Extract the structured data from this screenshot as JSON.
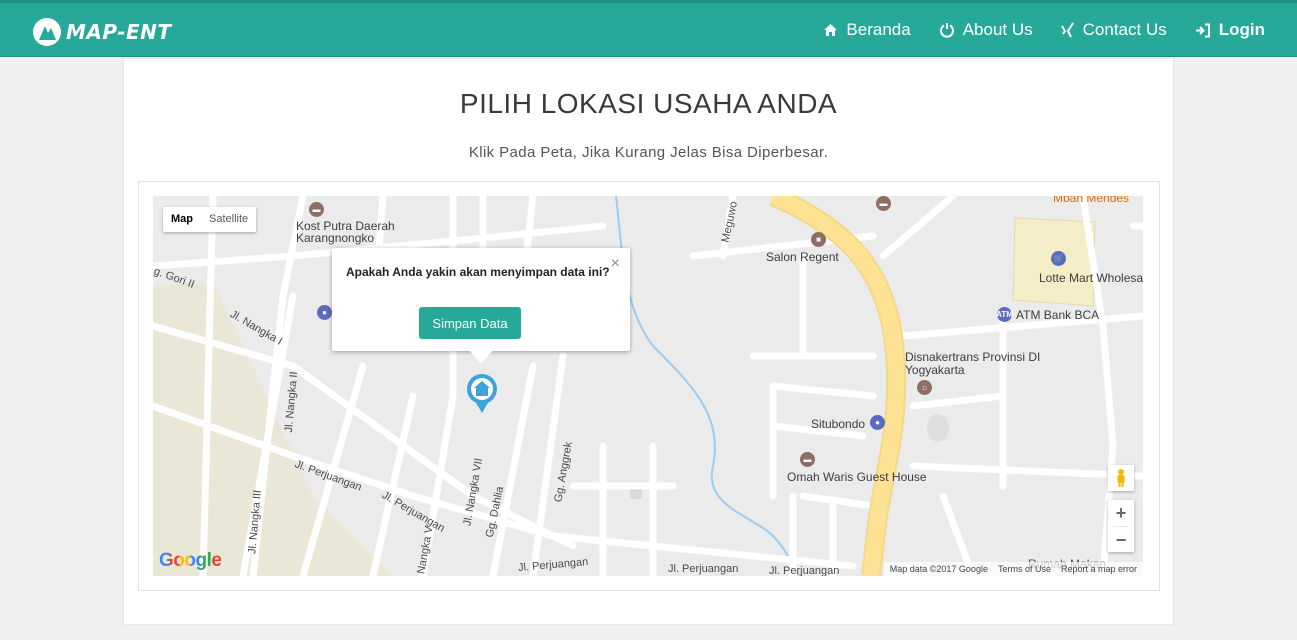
{
  "brand": {
    "name": "MAP-ENT"
  },
  "nav": {
    "items": [
      {
        "label": "Beranda",
        "icon": "home-icon"
      },
      {
        "label": "About Us",
        "icon": "power-icon"
      },
      {
        "label": "Contact Us",
        "icon": "xing-icon"
      },
      {
        "label": "Login",
        "icon": "sign-in-icon"
      }
    ]
  },
  "page": {
    "title": "PILIH LOKASI USAHA ANDA",
    "subtitle": "Klik Pada Peta, Jika Kurang Jelas Bisa Diperbesar."
  },
  "map": {
    "type_buttons": [
      "Map",
      "Satellite"
    ],
    "active_type": "Map",
    "zoom_in": "+",
    "zoom_out": "−",
    "google_logo": "Google",
    "attribution": [
      "Map data ©2017 Google",
      "Terms of Use",
      "Report a map error"
    ],
    "places": [
      "Kost Putra Daerah Karangnongko",
      "Salon Regent",
      "Lotte Mart Wholesa",
      "ATM Bank BCA",
      "Disnakertrans Provinsi DI Yogyakarta",
      "Situbondo",
      "Omah Waris Guest House",
      "Mbah Mendes",
      "Rumah Makan"
    ],
    "streets": [
      "Jl. Nangka I",
      "Jl. Nangka II",
      "Jl. Nangka III",
      "Jl. Nangka V",
      "Jl. Nangka VII",
      "Gg. Dahlia",
      "Gg. Anggrek",
      "Jl. Perjuangan",
      "Meguwo",
      "g. Gori II"
    ]
  },
  "infowindow": {
    "message": "Apakah Anda yakin akan menyimpan data ini?",
    "button_label": "Simpan Data",
    "close": "×"
  },
  "colors": {
    "accent": "#26a999",
    "road_major": "#fde293",
    "water": "#9ecbf0"
  }
}
